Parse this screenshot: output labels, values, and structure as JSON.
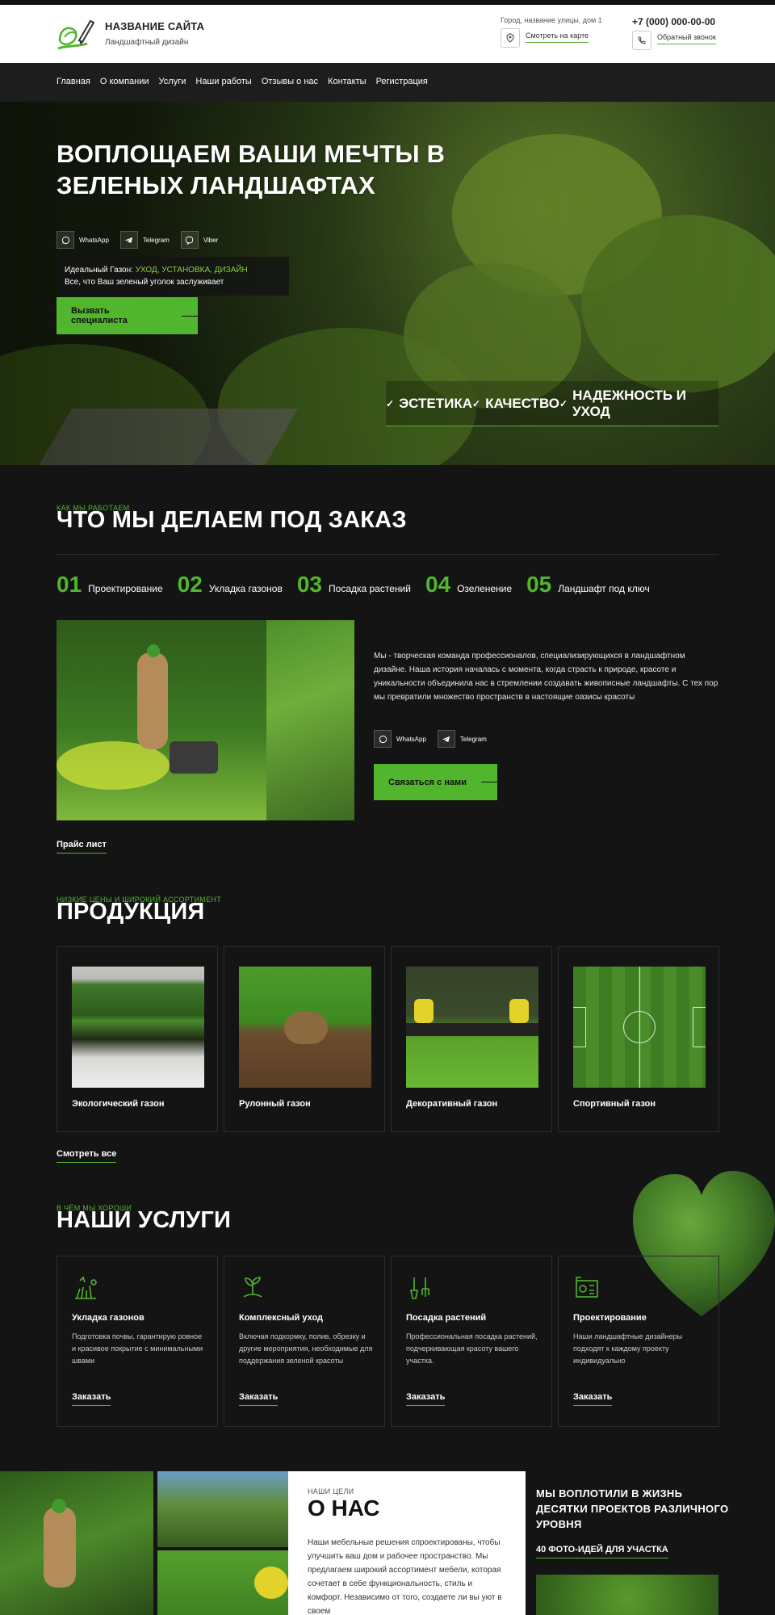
{
  "site": {
    "name": "НАЗВАНИЕ САЙТА",
    "subtitle": "Ландшафтный дизайн",
    "address": "Город, название улицы, дом 1",
    "map_link": "Смотреть на карте",
    "phone": "+7 (000) 000-00-00",
    "callback_link": "Обратный звонок"
  },
  "nav": [
    "Главная",
    "О компании",
    "Услуги",
    "Наши работы",
    "Отзывы о нас",
    "Контакты",
    "Регистрация"
  ],
  "hero": {
    "title": "ВОПЛОЩАЕМ ВАШИ МЕЧТЫ В ЗЕЛЕНЫХ ЛАНДШАФТАХ",
    "socials": [
      "WhatsApp",
      "Telegram",
      "Viber"
    ],
    "ideal_prefix": "Идеальный Газон:",
    "ideal_accent": "УХОД, УСТАНОВКА, ДИЗАЙН",
    "ideal_line2": "Все, что Ваш зеленый уголок заслуживает",
    "cta": "Вызвать специалиста",
    "qualities": [
      "ЭСТЕТИКА",
      "КАЧЕСТВО",
      "НАДЕЖНОСТЬ И УХОД"
    ]
  },
  "work": {
    "kicker": "КАК МЫ РАБОТАЕМ",
    "title": "ЧТО МЫ ДЕЛАЕМ ПОД ЗАКАЗ",
    "steps": [
      {
        "num": "01",
        "label": "Проектирование"
      },
      {
        "num": "02",
        "label": "Укладка газонов"
      },
      {
        "num": "03",
        "label": "Посадка растений"
      },
      {
        "num": "04",
        "label": "Озеленение"
      },
      {
        "num": "05",
        "label": "Ландшафт под ключ"
      }
    ],
    "text": "Мы - творческая команда профессионалов, специализирующихся в ландшафтном дизайне. Наша история началась с момента, когда страсть к природе, красоте и уникальности объединила нас в стремлении создавать живописные ландшафты. С тех пор мы превратили множество пространств в настоящие оазисы красоты",
    "socials": [
      "WhatsApp",
      "Telegram"
    ],
    "cta": "Связаться с нами",
    "price_link": "Прайс лист"
  },
  "products": {
    "kicker": "НИЗКИЕ ЦЕНЫ И ШИРОКИЙ АССОРТИМЕНТ",
    "title": "ПРОДУКЦИЯ",
    "items": [
      "Экологический газон",
      "Рулонный газон",
      "Декоративный газон",
      "Спортивный газон"
    ],
    "see_all": "Смотреть все"
  },
  "services": {
    "kicker": "В ЧЁМ МЫ ХОРОШИ",
    "title": "НАШИ УСЛУГИ",
    "items": [
      {
        "title": "Укладка газонов",
        "desc": "Подготовка почвы, гарантирую ровное и красивое покрытие с минимальными швами",
        "order": "Заказать"
      },
      {
        "title": "Комплексный уход",
        "desc": "Включая подкормку, полив, обрезку и другие мероприятия, необходимые для поддержания зеленой красоты",
        "order": "Заказать"
      },
      {
        "title": "Посадка растений",
        "desc": "Профессиональная посадка растений, подчеркивающая красоту вашего участка.",
        "order": "Заказать"
      },
      {
        "title": "Проектирование",
        "desc": "Наши ландшафтные дизайнеры подходят к каждому проекту индивидуально",
        "order": "Заказать"
      }
    ]
  },
  "about": {
    "kicker": "НАШИ ЦЕЛИ",
    "title": "О НАС",
    "text": "Наши мебельные решения спроектированы, чтобы улучшить ваш дом и рабочее пространство. Мы предлагаем широкий ассортимент мебели, которая сочетает в себе функциональность, стиль и комфорт. Независимо от того, создаете ли вы уют в своем",
    "ideas_title": "МЫ ВОПЛОТИЛИ В ЖИЗНЬ ДЕСЯТКИ ПРОЕКТОВ РАЗЛИЧНОГО УРОВНЯ",
    "ideas_link": "40 ФОТО-ИДЕЙ ДЛЯ УЧАСТКА"
  },
  "colors": {
    "accent": "#52b52e",
    "background": "#141414",
    "header": "#ffffff"
  }
}
